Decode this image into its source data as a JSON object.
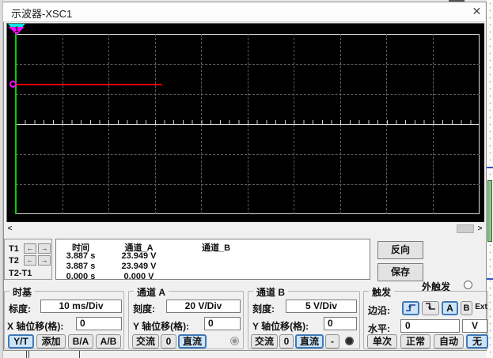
{
  "window": {
    "title": "示波器-XSC1",
    "close_glyph": "✕"
  },
  "scope": {
    "trace_color": "#ee0000",
    "cursor_color": "#00d200",
    "cursor_marker_digit": "1"
  },
  "scrollbar": {
    "left_arrow": "<",
    "right_arrow": ">"
  },
  "measure": {
    "left_arrow": "←",
    "right_arrow": "→",
    "headers": {
      "time": "时间",
      "cha": "通道_A",
      "chb": "通道_B"
    },
    "rows": [
      {
        "name": "T1",
        "time": "3.887 s",
        "a": "23.949 V",
        "b": ""
      },
      {
        "name": "T2",
        "time": "3.887 s",
        "a": "23.949 V",
        "b": ""
      },
      {
        "name": "T2-T1",
        "time": "0.000 s",
        "a": "0.000 V",
        "b": ""
      }
    ]
  },
  "side_buttons": {
    "reverse": "反向",
    "save": "保存",
    "ext_trigger_label": "外触发"
  },
  "timebase": {
    "title": "时基",
    "scale_label": "标度:",
    "scale_value": "10 ms/Div",
    "x_offset_label": "X 轴位移(格):",
    "x_offset_value": "0",
    "modes": [
      "Y/T",
      "添加",
      "B/A",
      "A/B"
    ]
  },
  "channel_a": {
    "title": "通道 A",
    "scale_label": "刻度:",
    "scale_value": "20  V/Div",
    "y_offset_label": "Y 轴位移(格):",
    "y_offset_value": "0",
    "coupling": [
      "交流",
      "0",
      "直流"
    ]
  },
  "channel_b": {
    "title": "通道 B",
    "scale_label": "刻度:",
    "scale_value": "5  V/Div",
    "y_offset_label": "Y 轴位移(格):",
    "y_offset_value": "0",
    "coupling": [
      "交流",
      "0",
      "直流",
      "-"
    ]
  },
  "trigger": {
    "title": "触发",
    "edge_label": "边沿:",
    "source_buttons": [
      "A",
      "B",
      "Ext"
    ],
    "level_label": "水平:",
    "level_value": "0",
    "level_unit": "V",
    "modes": [
      "单次",
      "正常",
      "自动",
      "无"
    ]
  }
}
